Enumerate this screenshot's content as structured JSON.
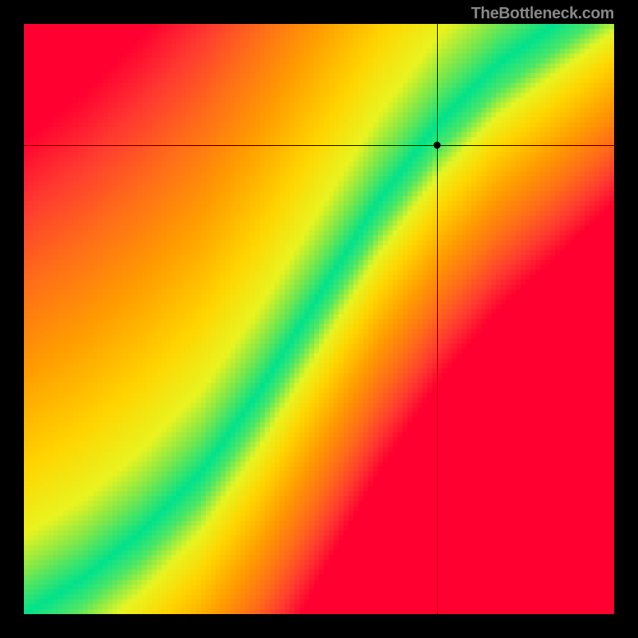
{
  "attribution": "TheBottleneck.com",
  "chart_data": {
    "type": "heatmap",
    "title": "",
    "xlabel": "",
    "ylabel": "",
    "xlim": [
      0,
      1
    ],
    "ylim": [
      0,
      1
    ],
    "grid_resolution": 120,
    "crosshair": {
      "x": 0.7,
      "y": 0.795
    },
    "marker": {
      "x": 0.7,
      "y": 0.795
    },
    "optimal_curve": {
      "description": "Green ridge y = f(x); piecewise-linear estimate from pixels",
      "points": [
        {
          "x": 0.0,
          "y": 0.0
        },
        {
          "x": 0.1,
          "y": 0.06
        },
        {
          "x": 0.2,
          "y": 0.14
        },
        {
          "x": 0.3,
          "y": 0.24
        },
        {
          "x": 0.4,
          "y": 0.38
        },
        {
          "x": 0.5,
          "y": 0.54
        },
        {
          "x": 0.6,
          "y": 0.7
        },
        {
          "x": 0.7,
          "y": 0.83
        },
        {
          "x": 0.8,
          "y": 0.93
        },
        {
          "x": 0.9,
          "y": 1.0
        }
      ]
    },
    "color_stops": [
      {
        "t": 0.0,
        "color": "#00e28c"
      },
      {
        "t": 0.08,
        "color": "#7de84b"
      },
      {
        "t": 0.16,
        "color": "#e8f420"
      },
      {
        "t": 0.3,
        "color": "#ffd400"
      },
      {
        "t": 0.5,
        "color": "#ff9d00"
      },
      {
        "t": 0.7,
        "color": "#ff6a1a"
      },
      {
        "t": 0.85,
        "color": "#ff3a30"
      },
      {
        "t": 1.0,
        "color": "#ff0030"
      }
    ],
    "ridge_half_width": 0.045,
    "falloff_scale_left": 0.55,
    "falloff_scale_right": 0.95
  }
}
